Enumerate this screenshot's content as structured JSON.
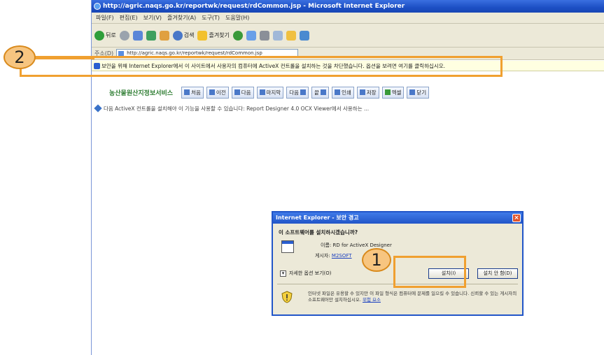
{
  "window": {
    "title": "http://agric.naqs.go.kr/reportwk/request/rdCommon.jsp - Microsoft Internet Explorer",
    "menu": [
      "파일(F)",
      "편집(E)",
      "보기(V)",
      "즐겨찾기(A)",
      "도구(T)",
      "도움말(H)"
    ],
    "toolbar": {
      "back_label": "뒤로",
      "search_label": "검색",
      "favorites_label": "즐겨찾기"
    },
    "address": {
      "label": "주소(D)",
      "value": "http://agric.naqs.go.kr/reportwk/request/rdCommon.jsp"
    },
    "infobar_text": "보안을 위해 Internet Explorer에서 이 사이트에서 사용자의 컴퓨터에 ActiveX 컨트롤을 설치하는 것을 차단했습니다. 옵션을 보려면 여기를 클릭하십시오."
  },
  "viewer": {
    "logo": "농산물원산지정보서비스",
    "buttons": [
      "처음",
      "이전",
      "다음",
      "마지막",
      "다음",
      "끝",
      "인쇄",
      "저장",
      "엑셀",
      "닫기"
    ],
    "notice": "다음 ActiveX 컨트롤을 설치해야 이 기능을 사용할 수 있습니다: Report Designer 4.0 OCX Viewer에서 사용하는 ..."
  },
  "dialog": {
    "title": "Internet Explorer - 보안 경고",
    "question": "이 소프트웨어를 설치하시겠습니까?",
    "name_line": "이름: RD for ActiveX Designer",
    "publisher_label": "게시자:",
    "publisher_value": "M2SOFT",
    "more_options": "자세한 옵션 보기(O)",
    "install_label": "설치(I)",
    "dont_install_label": "설치 안 함(D)",
    "warning": "인터넷 파일은 유용할 수 있지만 이 파일 형식은 컴퓨터에 문제를 일으킬 수 있습니다. 신뢰할 수 있는 게시자의 소프트웨어만 설치하십시오.",
    "risk_link": "위험 요소"
  },
  "annotations": {
    "badge_1": "1",
    "badge_2": "2"
  },
  "colors": {
    "callout": "#f0a030",
    "badge_fill": "#f7c580",
    "titlebar": "#1c4fc4",
    "infobar_bg": "#ffffe1"
  }
}
